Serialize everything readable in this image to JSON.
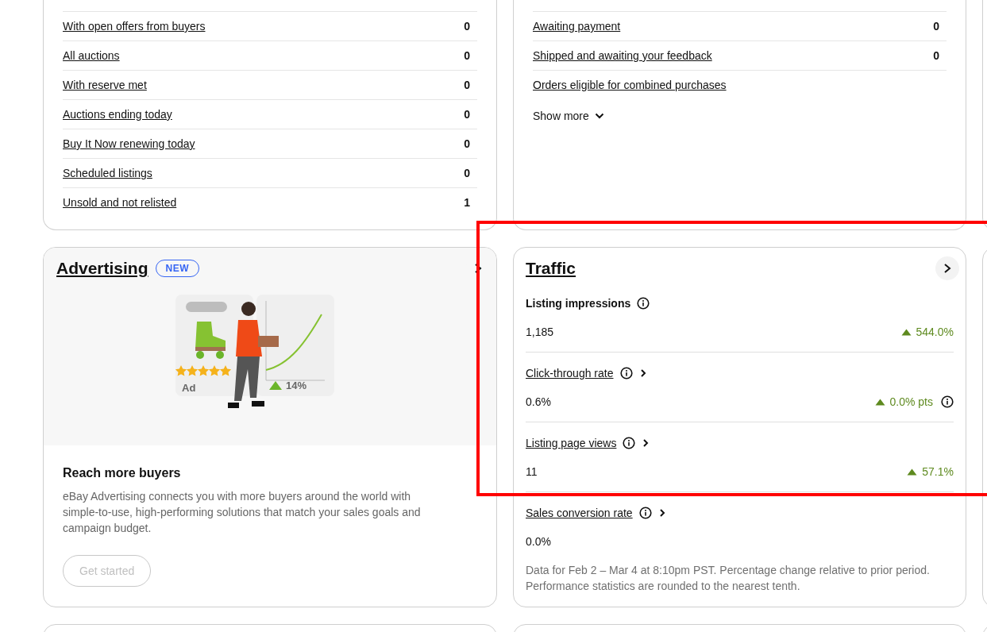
{
  "listings_card": {
    "rows": [
      {
        "label": "With open offers from buyers",
        "count": "0"
      },
      {
        "label": "All auctions",
        "count": "0"
      },
      {
        "label": "With reserve met",
        "count": "0"
      },
      {
        "label": "Auctions ending today",
        "count": "0"
      },
      {
        "label": "Buy It Now renewing today",
        "count": "0"
      },
      {
        "label": "Scheduled listings",
        "count": "0"
      },
      {
        "label": "Unsold and not relisted",
        "count": "1"
      }
    ]
  },
  "orders_card": {
    "rows": [
      {
        "label": "Awaiting payment",
        "count": "0"
      },
      {
        "label": "Shipped and awaiting your feedback",
        "count": "0"
      },
      {
        "label": "Orders eligible for combined purchases"
      }
    ],
    "show_more": "Show more"
  },
  "advertising_card": {
    "title": "Advertising",
    "badge": "NEW",
    "illustration": {
      "ad_label": "Ad",
      "stars": 5,
      "trend": "14%"
    },
    "heading": "Reach more buyers",
    "description": "eBay Advertising connects you with more buyers around the world with simple-to-use, high-performing solutions that match your sales goals and campaign budget.",
    "button": {
      "label": "Get started",
      "disabled": true
    }
  },
  "traffic_card": {
    "title": "Traffic",
    "metrics": [
      {
        "kind": "heading",
        "label": "Listing impressions",
        "value": "1,185",
        "change": "544.0%",
        "change_info": false
      },
      {
        "kind": "link",
        "label": "Click-through rate",
        "value": "0.6%",
        "change": "0.0% pts",
        "change_info": true
      },
      {
        "kind": "link",
        "label": "Listing page views",
        "value": "11",
        "change": "57.1%",
        "change_info": false
      },
      {
        "kind": "link",
        "label": "Sales conversion rate",
        "value": "0.0%"
      }
    ],
    "note": "Data for Feb 2 – Mar 4 at 8:10pm PST. Percentage change relative to prior period. Performance statistics are rounded to the nearest tenth."
  }
}
